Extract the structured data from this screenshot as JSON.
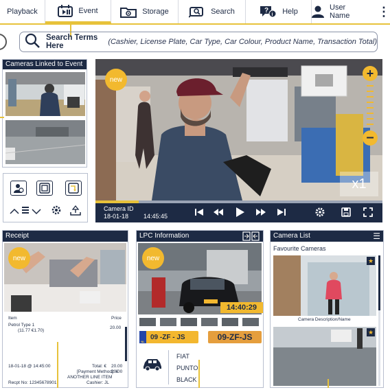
{
  "nav": {
    "items": [
      {
        "label": "Playback",
        "icon": "playback-icon"
      },
      {
        "label": "Event",
        "icon": "event-icon"
      },
      {
        "label": "Storage",
        "icon": "storage-icon"
      },
      {
        "label": "Search",
        "icon": "search-camera-icon"
      },
      {
        "label": "Help",
        "icon": "help-icon"
      },
      {
        "label": "User Name",
        "icon": "user-icon"
      }
    ],
    "active": "Event"
  },
  "search": {
    "label": "Search Terms Here",
    "hint": "(Cashier, License Plate, Car Type, Car Colour, Product Name, Transaction Total)"
  },
  "linked": {
    "title": "Cameras Linked to Event"
  },
  "video": {
    "badge": "new",
    "speed": "x1",
    "camera_id_label": "Camera ID",
    "date": "18-01-18",
    "time": "14:45:45",
    "progress": 0.15,
    "zoom_in_icon": "plus-icon",
    "zoom_out_icon": "minus-icon"
  },
  "receipt": {
    "title": "Receipt",
    "badge": "new",
    "col_item": "Item",
    "col_price": "Price",
    "line1": "Petrol Type 1",
    "line1_price": "20.00",
    "line1_sub": "(11.77 €1.70)",
    "datetime": "18-01-18 @ 14:45:00",
    "total_label": "Total: €",
    "total_value": "20.00",
    "payment_label": "[Payment Method]: €",
    "payment_value": "20.00",
    "another": "ANOTHER LINE ITEM",
    "cashier": "Cashier: JL",
    "recpt_no": "Recpt No: 12345678901"
  },
  "lpc": {
    "title": "LPC Information",
    "badge": "new",
    "timestamp": "14:40:29",
    "plate_text": "09 -ZF - JS",
    "plate_crop": "09-ZF-JS",
    "make": "FIAT",
    "model": "PUNTO",
    "colour": "BLACK"
  },
  "camlist": {
    "title": "Camera List",
    "subtitle": "Favourite Cameras",
    "caption": "Camera Description/Name"
  },
  "colors": {
    "navy": "#1d2a44",
    "accent": "#e7c23a",
    "badge": "#f2b92f"
  }
}
